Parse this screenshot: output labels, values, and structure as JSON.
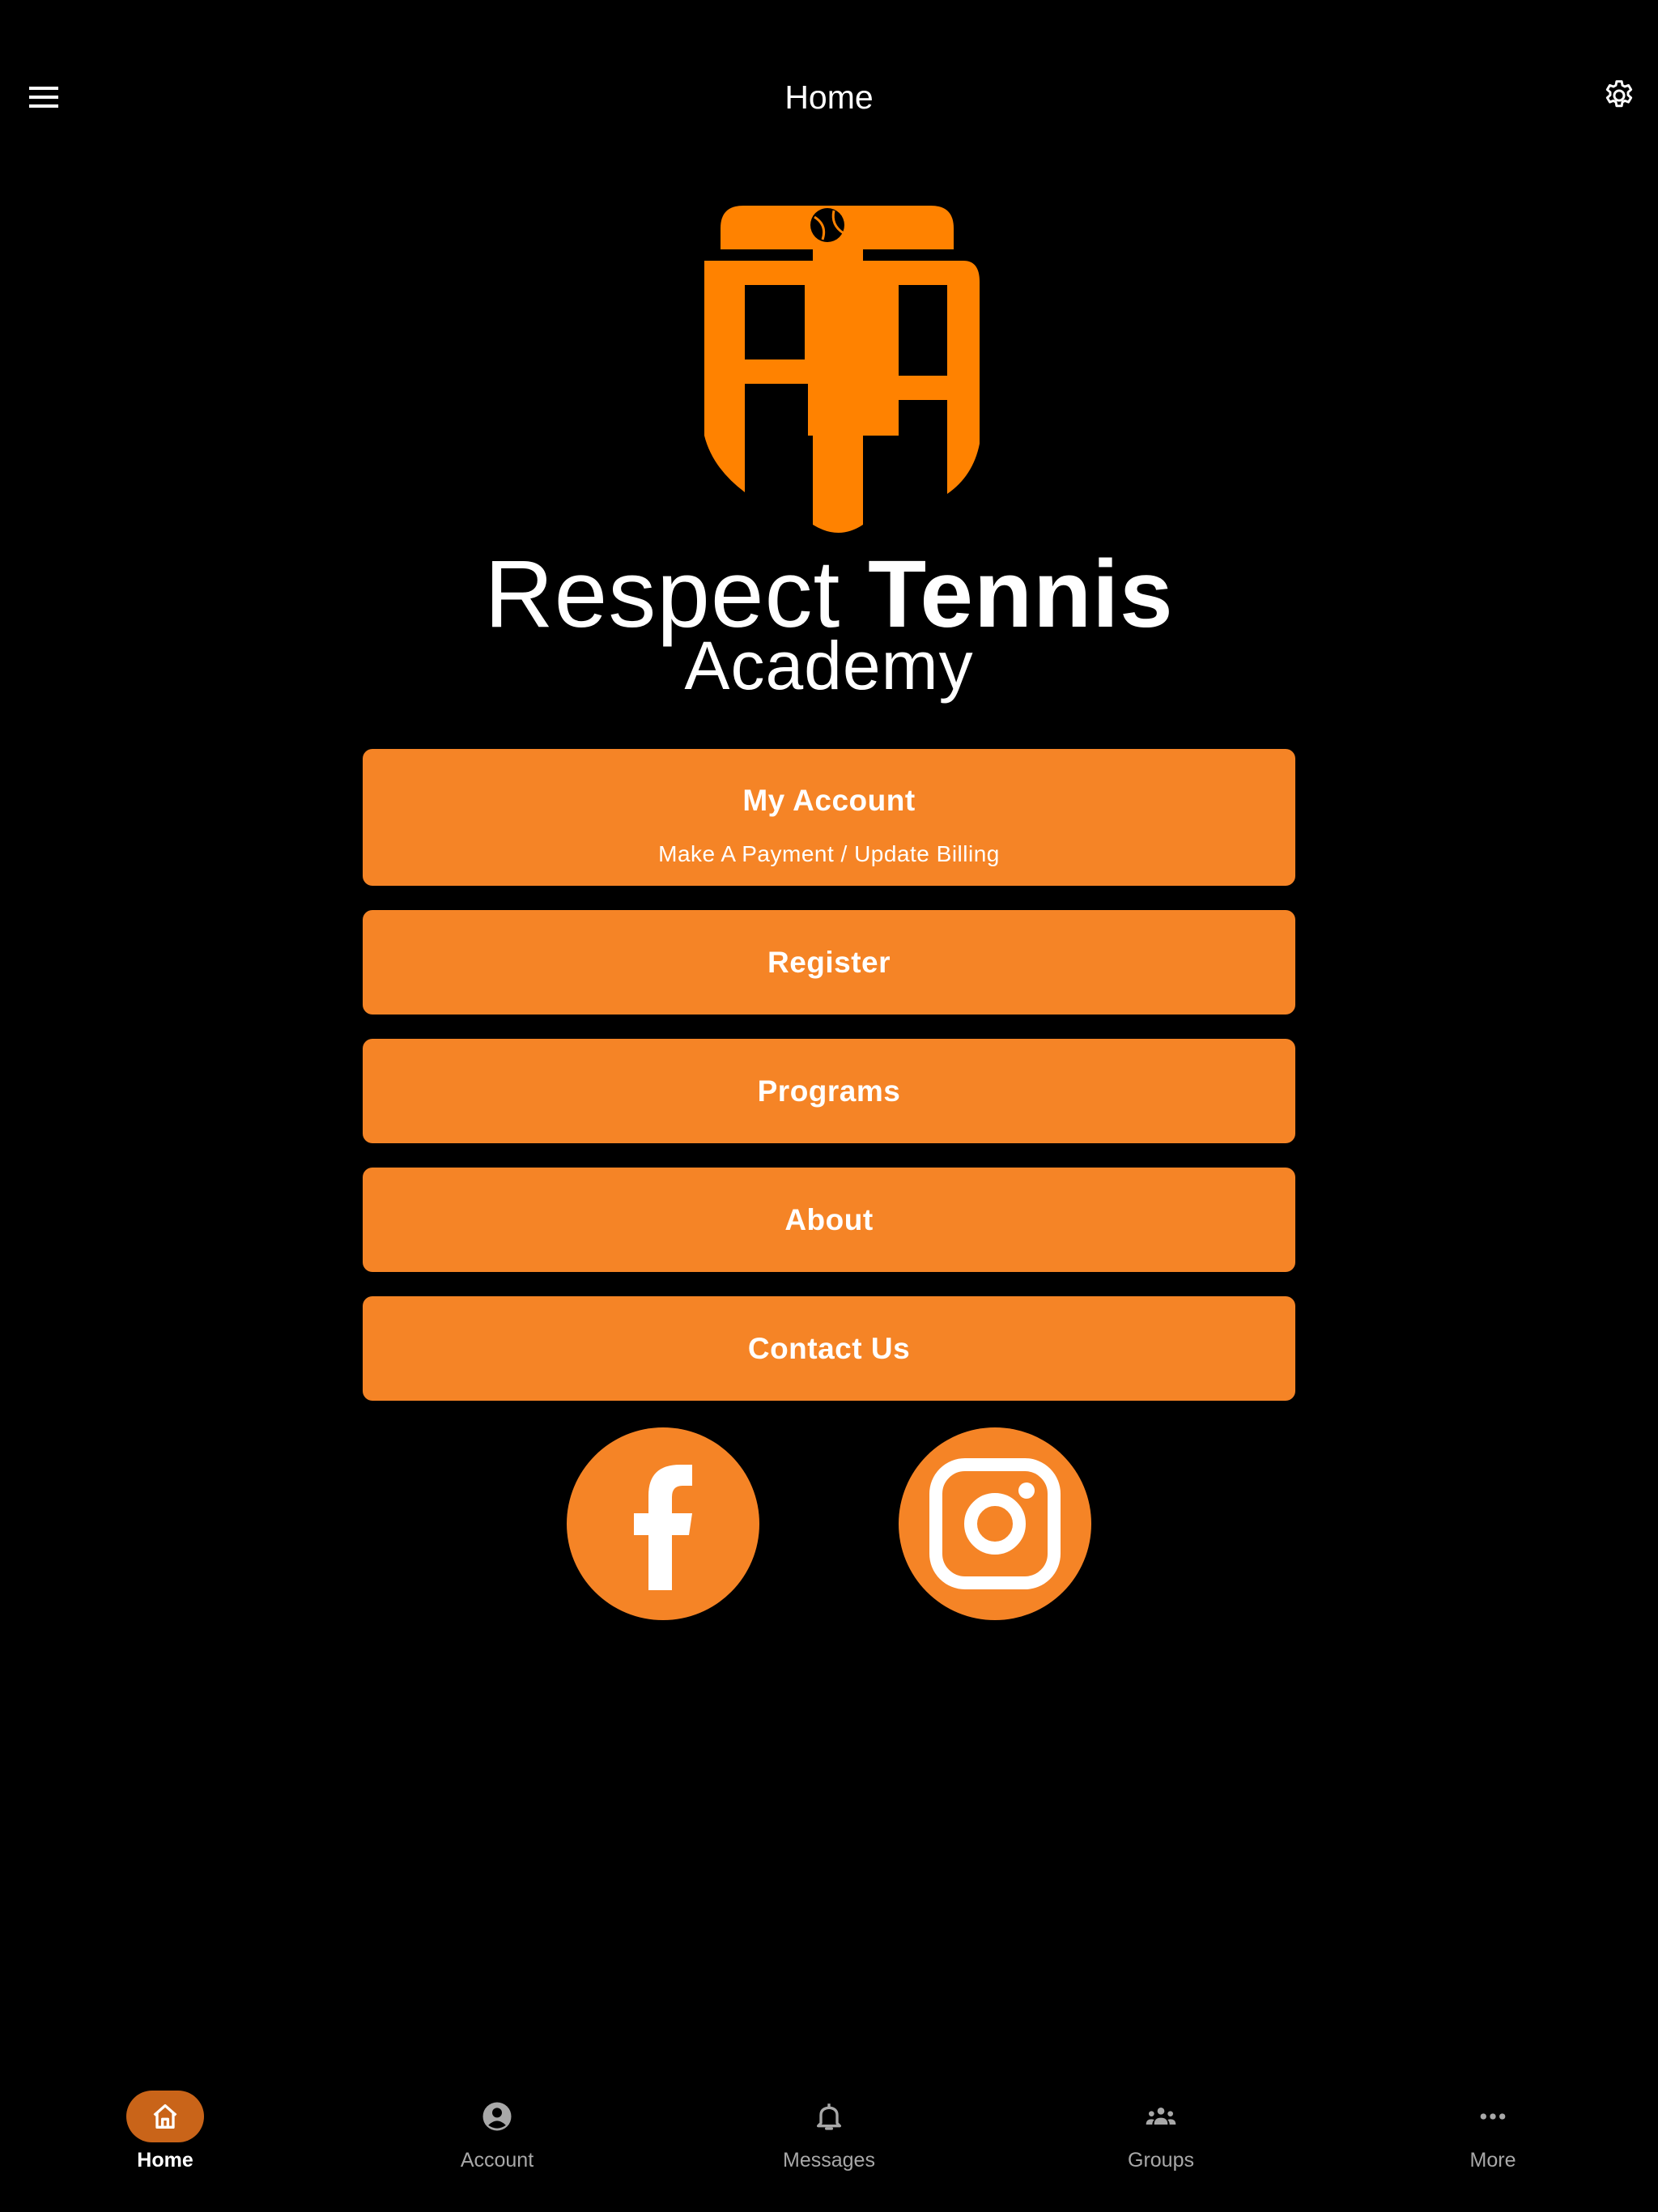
{
  "header": {
    "title": "Home",
    "menu_icon": "hamburger-menu-icon",
    "settings_icon": "gear-icon"
  },
  "logo": {
    "monogram": "RTA",
    "line1_light": "Respect",
    "line1_bold": "Tennis",
    "line2": "Academy",
    "color": "#ff8200"
  },
  "buttons": {
    "my_account": {
      "label": "My Account",
      "sublabel": "Make A Payment / Update Billing"
    },
    "register": {
      "label": "Register"
    },
    "programs": {
      "label": "Programs"
    },
    "about": {
      "label": "About"
    },
    "contact": {
      "label": "Contact Us"
    }
  },
  "social": {
    "facebook_icon": "facebook-icon",
    "instagram_icon": "instagram-icon"
  },
  "bottom_nav": {
    "items": [
      {
        "label": "Home",
        "icon": "home-icon",
        "active": true
      },
      {
        "label": "Account",
        "icon": "account-circle-icon",
        "active": false
      },
      {
        "label": "Messages",
        "icon": "bell-icon",
        "active": false
      },
      {
        "label": "Groups",
        "icon": "groups-icon",
        "active": false
      },
      {
        "label": "More",
        "icon": "more-dots-icon",
        "active": false
      }
    ]
  },
  "colors": {
    "accent": "#f58426",
    "nav_active_pill": "#c96419",
    "background": "#000000",
    "nav_inactive_text": "#a8a8a8"
  }
}
